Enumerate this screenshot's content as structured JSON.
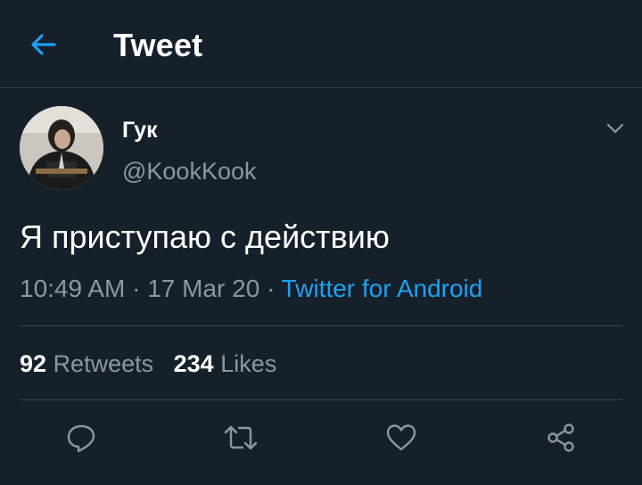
{
  "header": {
    "title": "Tweet",
    "back_icon": "arrow-left-icon"
  },
  "tweet": {
    "author": {
      "display_name": "Гук",
      "handle": "@KookKook"
    },
    "text": "Я приступаю с действию",
    "time": "10:49 AM",
    "date": "17 Mar 20",
    "separator": "·",
    "source": "Twitter for Android"
  },
  "stats": {
    "retweets_count": "92",
    "retweets_label": "Retweets",
    "likes_count": "234",
    "likes_label": "Likes"
  },
  "actions": [
    "reply-icon",
    "retweet-icon",
    "like-icon",
    "share-icon"
  ],
  "colors": {
    "background": "#15202b",
    "accent": "#1da1f2",
    "secondary_text": "#8899a6",
    "divider": "#38444d"
  }
}
